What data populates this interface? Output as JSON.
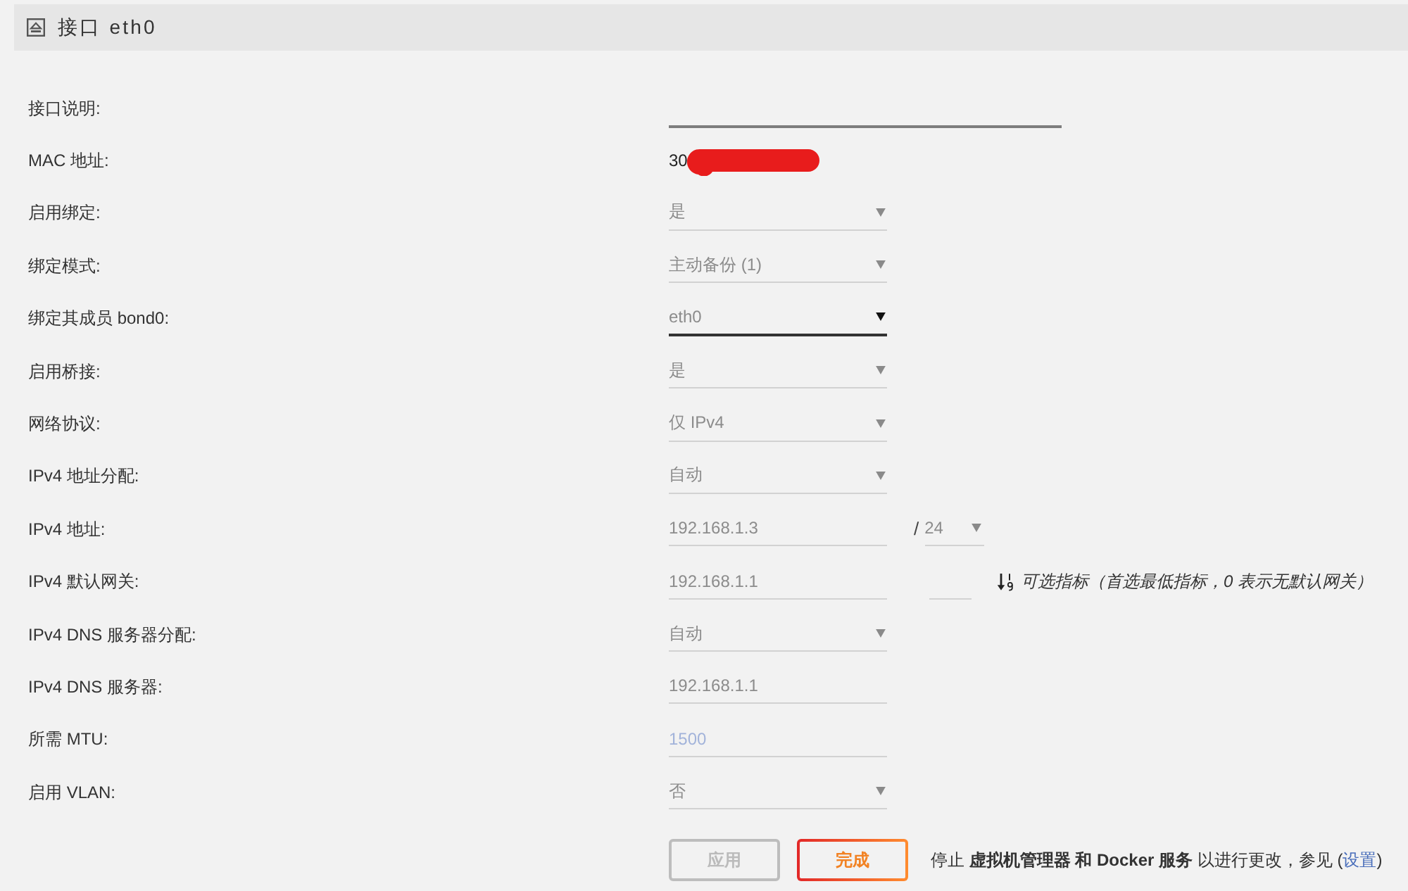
{
  "header": {
    "title": "接口 eth0"
  },
  "fields": [
    {
      "label": "接口说明:",
      "kind": "text",
      "wide": true,
      "disabled": false
    },
    {
      "label": "MAC 地址:",
      "kind": "static",
      "value": "30",
      "redacted": true
    },
    {
      "label": "启用绑定:",
      "kind": "select",
      "value": "是",
      "disabled": true
    },
    {
      "label": "绑定模式:",
      "kind": "select",
      "value": "主动备份 (1)",
      "disabled": true
    },
    {
      "label": "绑定其成员 bond0:",
      "kind": "select",
      "value": "eth0",
      "disabled": false
    },
    {
      "label": "启用桥接:",
      "kind": "select",
      "value": "是",
      "disabled": true
    },
    {
      "label": "网络协议:",
      "kind": "select",
      "value": "仅 IPv4",
      "disabled": true
    },
    {
      "label": "IPv4 地址分配:",
      "kind": "select",
      "value": "自动",
      "disabled": true
    },
    {
      "label": "IPv4 地址:",
      "kind": "address",
      "value": "192.168.1.3",
      "disabled": true,
      "separator": "/",
      "prefix": {
        "value": "24",
        "disabled": true
      }
    },
    {
      "label": "IPv4 默认网关:",
      "kind": "gateway",
      "value": "192.168.1.1",
      "disabled": true,
      "hint": "可选指标（首选最低指标，0 表示无默认网关）"
    },
    {
      "label": "IPv4 DNS 服务器分配:",
      "kind": "select",
      "value": "自动",
      "disabled": true
    },
    {
      "label": "IPv4 DNS 服务器:",
      "kind": "text",
      "value": "192.168.1.1",
      "disabled": true
    },
    {
      "label": "所需 MTU:",
      "kind": "text",
      "placeholder": "1500",
      "disabled": true
    },
    {
      "label": "启用 VLAN:",
      "kind": "select",
      "value": "否",
      "disabled": true
    }
  ],
  "buttons": [
    {
      "label": "应用",
      "kind": "plain",
      "disabled": true
    },
    {
      "label": "完成",
      "kind": "primary",
      "disabled": false
    }
  ],
  "note": {
    "text": "停止 **虚拟机管理器 和 Docker 服务** 以进行更改，参见 (",
    "link": "设置",
    "text_end": ")"
  }
}
